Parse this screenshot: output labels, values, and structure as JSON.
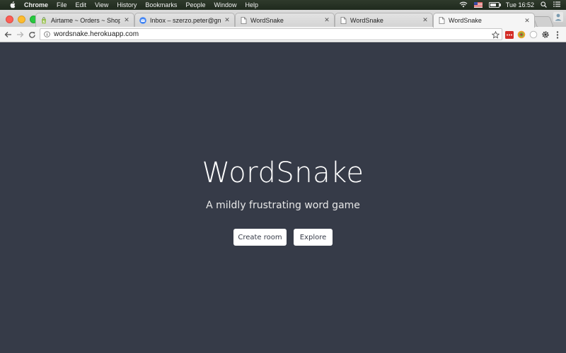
{
  "menubar": {
    "app_name": "Chrome",
    "items": [
      "File",
      "Edit",
      "View",
      "History",
      "Bookmarks",
      "People",
      "Window",
      "Help"
    ],
    "clock": "Tue 16:52"
  },
  "tabs": [
    {
      "title": "Airtame ~ Orders ~ Shopify",
      "favicon": "shopify-bag-icon",
      "active": false
    },
    {
      "title": "Inbox – szerzo.peter@gmail.co",
      "favicon": "inbox-envelope-icon",
      "active": false
    },
    {
      "title": "WordSnake",
      "favicon": "page-icon",
      "active": false
    },
    {
      "title": "WordSnake",
      "favicon": "page-icon",
      "active": false
    },
    {
      "title": "WordSnake",
      "favicon": "page-icon",
      "active": true
    }
  ],
  "toolbar": {
    "url": "wordsnake.herokuapp.com"
  },
  "page": {
    "title": "WordSnake",
    "subtitle": "A mildly frustrating word game",
    "buttons": {
      "create_room": "Create room",
      "explore": "Explore"
    }
  },
  "colors": {
    "page_background": "#363b48",
    "button_background": "#ffffff",
    "button_text": "#363b48"
  }
}
